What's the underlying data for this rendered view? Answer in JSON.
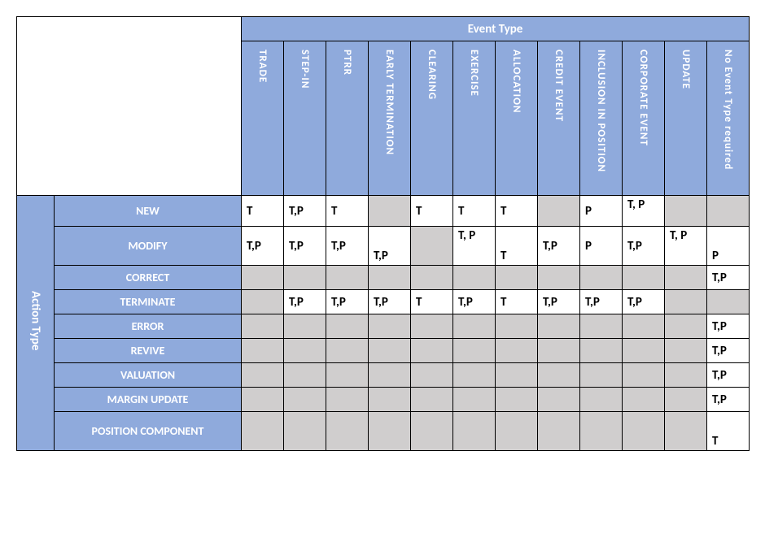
{
  "headers": {
    "event_type": "Event Type",
    "action_type": "Action Type",
    "columns": [
      "TRADE",
      "STEP-IN",
      "PTRR",
      "EARLY TERMINATION",
      "CLEARING",
      "EXERCISE",
      "ALLOCATION",
      "CREDIT EVENT",
      "INCLUSION IN POSITION",
      "CORPORATE EVENT",
      "UPDATE",
      "No Event Type required"
    ],
    "rows": [
      "NEW",
      "MODIFY",
      "CORRECT",
      "TERMINATE",
      "ERROR",
      "REVIVE",
      "VALUATION",
      "MARGIN UPDATE",
      "POSITION COMPONENT"
    ]
  },
  "chart_data": {
    "type": "table",
    "column_labels": [
      "TRADE",
      "STEP-IN",
      "PTRR",
      "EARLY TERMINATION",
      "CLEARING",
      "EXERCISE",
      "ALLOCATION",
      "CREDIT EVENT",
      "INCLUSION IN POSITION",
      "CORPORATE EVENT",
      "UPDATE",
      "No Event Type required"
    ],
    "row_labels": [
      "NEW",
      "MODIFY",
      "CORRECT",
      "TERMINATE",
      "ERROR",
      "REVIVE",
      "VALUATION",
      "MARGIN UPDATE",
      "POSITION COMPONENT"
    ],
    "cells": [
      [
        "T",
        "T,P",
        "T",
        "",
        "T",
        "T",
        "T",
        "",
        "P",
        "T, P",
        "",
        ""
      ],
      [
        "T,P",
        "T,P",
        "T,P",
        "T,P",
        "",
        "T, P",
        "T",
        "T,P",
        "P",
        "T,P",
        "T, P",
        "P"
      ],
      [
        "",
        "",
        "",
        "",
        "",
        "",
        "",
        "",
        "",
        "",
        "",
        "T,P"
      ],
      [
        "",
        "T,P",
        "T,P",
        "T,P",
        "T",
        "T,P",
        "T",
        "T,P",
        "T,P",
        "T,P",
        "",
        ""
      ],
      [
        "",
        "",
        "",
        "",
        "",
        "",
        "",
        "",
        "",
        "",
        "",
        "T,P"
      ],
      [
        "",
        "",
        "",
        "",
        "",
        "",
        "",
        "",
        "",
        "",
        "",
        "T,P"
      ],
      [
        "",
        "",
        "",
        "",
        "",
        "",
        "",
        "",
        "",
        "",
        "",
        "T,P"
      ],
      [
        "",
        "",
        "",
        "",
        "",
        "",
        "",
        "",
        "",
        "",
        "",
        "T,P"
      ],
      [
        "",
        "",
        "",
        "",
        "",
        "",
        "",
        "",
        "",
        "",
        "",
        "T"
      ]
    ]
  }
}
